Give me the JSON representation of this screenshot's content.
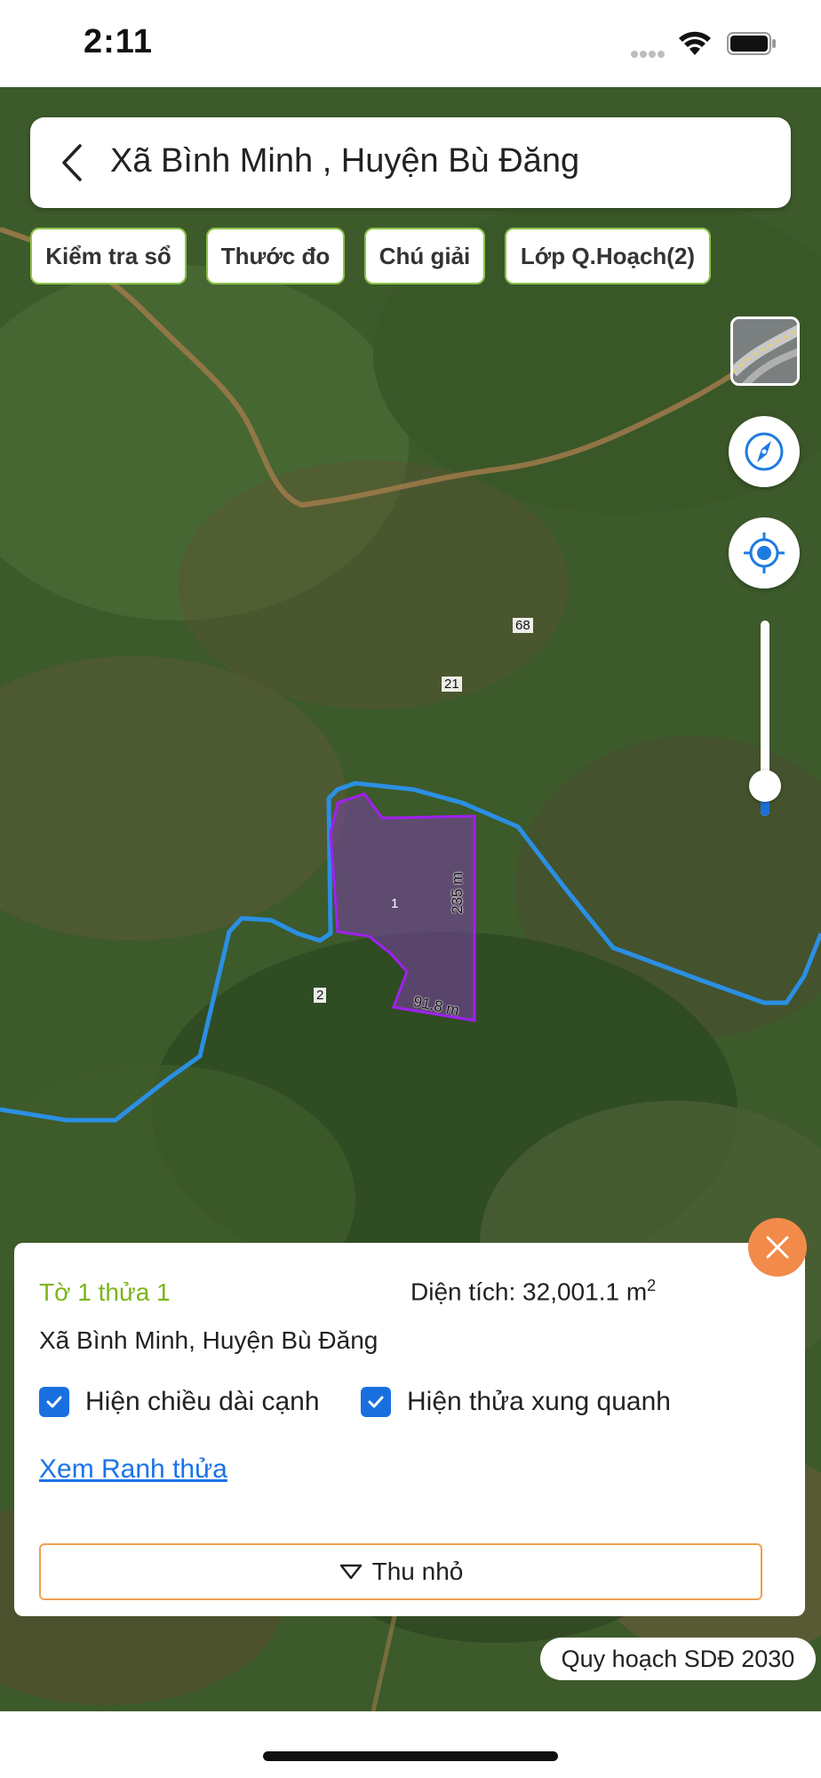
{
  "status_bar": {
    "time": "2:11"
  },
  "header": {
    "title": "Xã Bình Minh , Huyện Bù Đăng"
  },
  "chips": [
    {
      "label": "Kiểm tra sổ"
    },
    {
      "label": "Thước đo"
    },
    {
      "label": "Chú giải"
    },
    {
      "label": "Lớp Q.Hoạch(2)"
    }
  ],
  "map": {
    "parcel_labels": [
      "68",
      "21",
      "1",
      "2"
    ],
    "edge_lengths": [
      "235 m",
      "91.8 m"
    ],
    "zoom_level": 0.12,
    "colors": {
      "parcel_fill": "#7b3fa8",
      "parcel_border": "#a020f0",
      "boundary_line": "#2196f3"
    }
  },
  "info_panel": {
    "parcel_title": "Tờ 1 thửa 1",
    "area_label": "Diện tích: 32,001.1 m",
    "area_unit_sup": "2",
    "address": "Xã Bình Minh, Huyện Bù Đăng",
    "checkboxes": [
      {
        "label": "Hiện chiều dài cạnh",
        "checked": true
      },
      {
        "label": "Hiện thửa xung quanh",
        "checked": true
      }
    ],
    "link_label": "Xem Ranh thửa",
    "collapse_label": "Thu nhỏ"
  },
  "plan_badge": "Quy hoạch SDĐ 2030"
}
